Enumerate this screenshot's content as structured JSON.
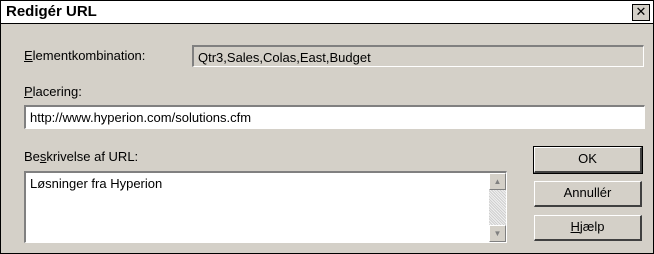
{
  "dialog": {
    "title": "Redigér URL",
    "close_glyph": "✕"
  },
  "element_combination": {
    "label_first": "E",
    "label_rest": "lementkombination:",
    "value": "Qtr3,Sales,Colas,East,Budget"
  },
  "placement": {
    "label_first": "P",
    "label_rest": "lacering:",
    "value": "http://www.hyperion.com/solutions.cfm"
  },
  "description": {
    "label_before": "Be",
    "label_underlined": "s",
    "label_after": "krivelse af URL:",
    "value": "Løsninger fra Hyperion"
  },
  "buttons": {
    "ok": "OK",
    "cancel": "Annullér",
    "help_first": "H",
    "help_rest": "jælp"
  },
  "icons": {
    "close": "close-icon",
    "scroll_up": "scroll-up-arrow-icon",
    "scroll_down": "scroll-down-arrow-icon"
  }
}
